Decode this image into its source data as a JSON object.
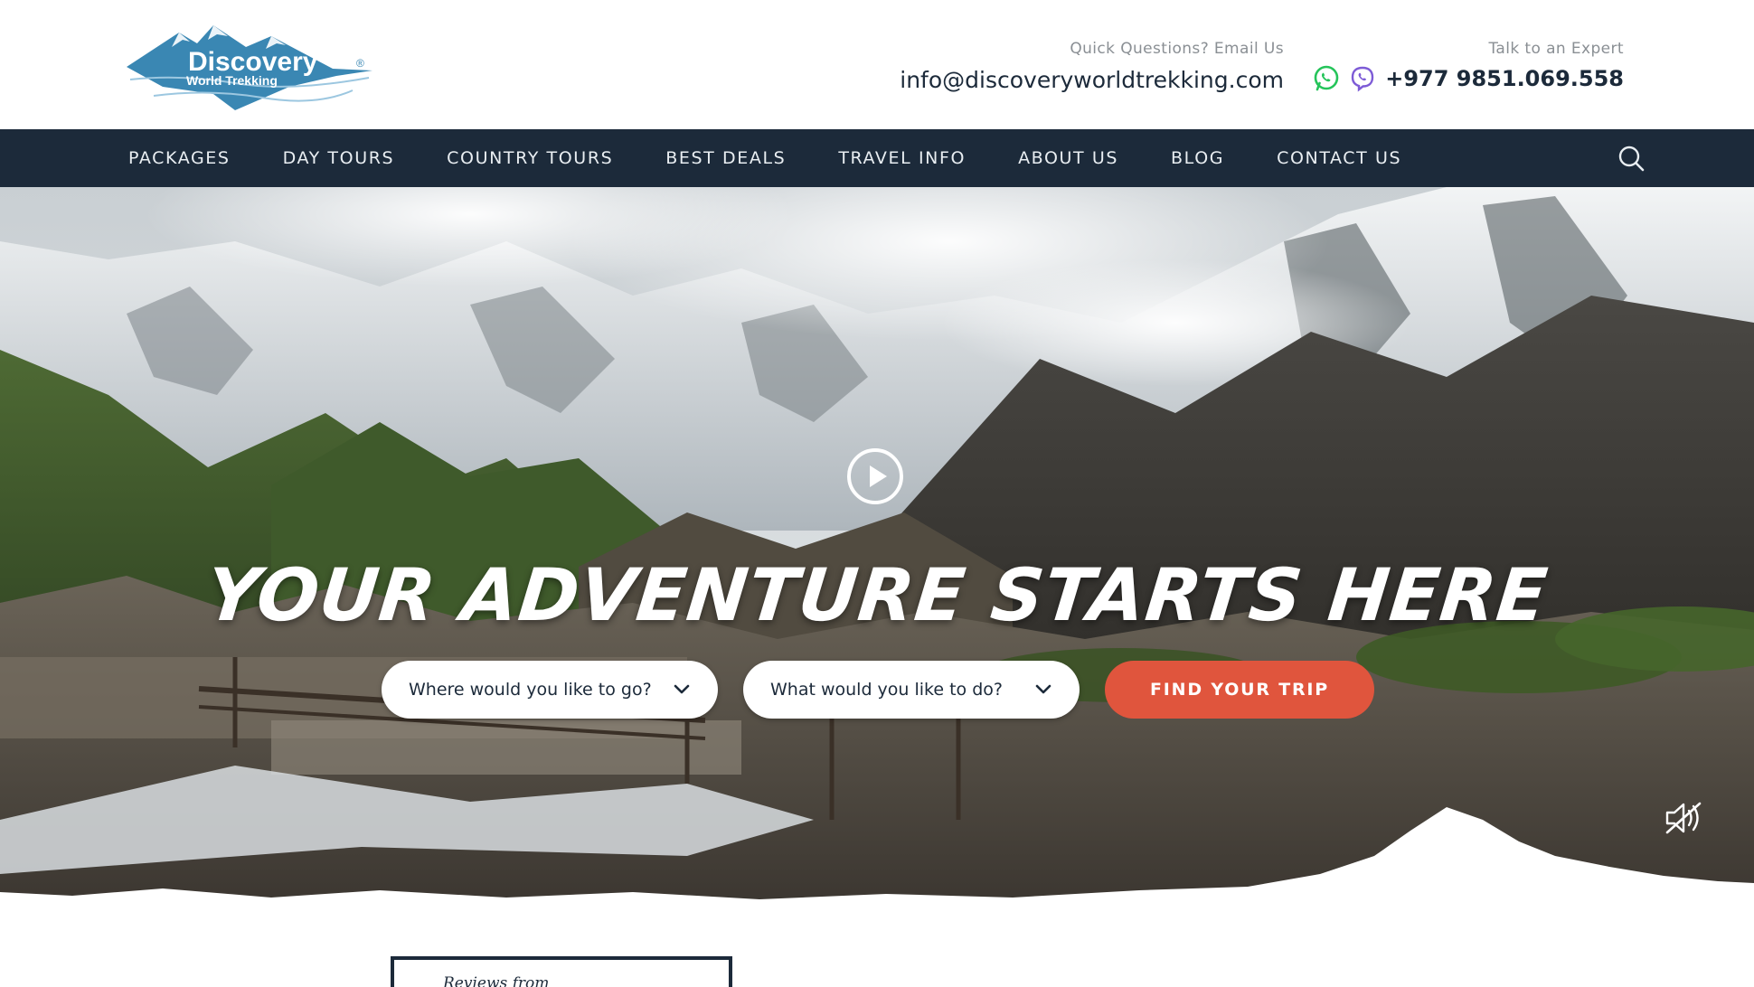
{
  "brand": {
    "name": "Discovery",
    "tagline": "World Trekking",
    "registered": "®",
    "colors": {
      "logo_blue": "#3a87b3",
      "navy": "#1c2a3a",
      "accent": "#e0553d"
    }
  },
  "header": {
    "email_label": "Quick Questions? Email Us",
    "email": "info@discoveryworldtrekking.com",
    "phone_label": "Talk to an Expert",
    "phone": "+977 9851.069.558",
    "icons": [
      "whatsapp-icon",
      "viber-icon"
    ]
  },
  "nav": {
    "items": [
      "PACKAGES",
      "DAY TOURS",
      "COUNTRY TOURS",
      "BEST DEALS",
      "TRAVEL INFO",
      "ABOUT US",
      "BLOG",
      "CONTACT US"
    ],
    "search_icon": "search-icon"
  },
  "hero": {
    "title": "YOUR ADVENTURE STARTS HERE",
    "destination_select": "Where would you like to go?",
    "activity_select": "What would you like to do?",
    "cta": "FIND YOUR TRIP",
    "play_icon": "play-icon",
    "mute_icon": "mute-icon"
  },
  "reviews": {
    "heading": "Reviews from"
  }
}
